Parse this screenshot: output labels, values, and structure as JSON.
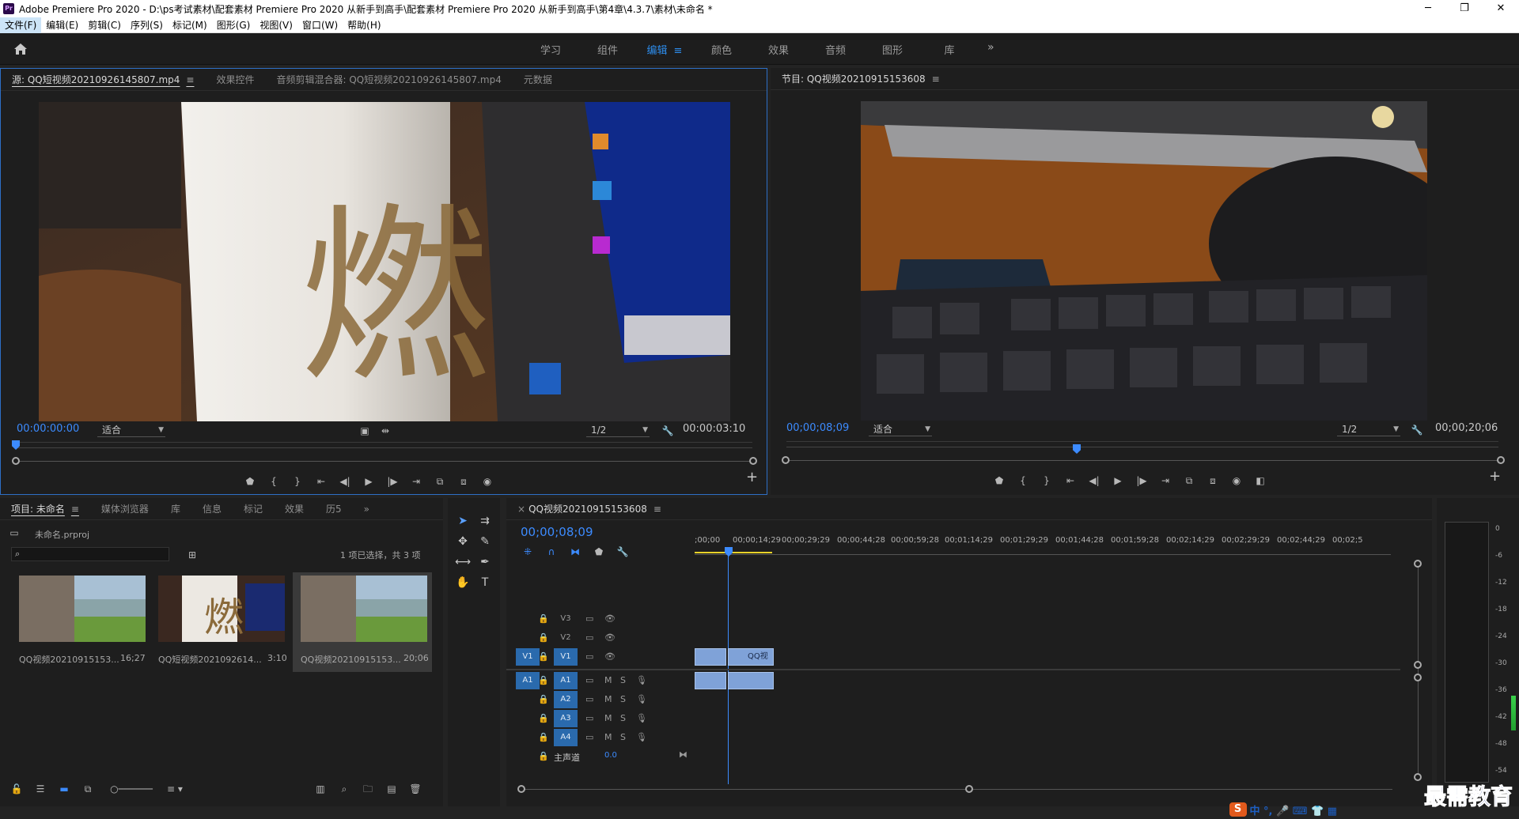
{
  "window": {
    "app_icon": "Pr",
    "title": "Adobe Premiere Pro 2020 - D:\\ps考试素材\\配套素材 Premiere Pro 2020 从新手到高手\\配套素材 Premiere Pro 2020 从新手到高手\\第4章\\4.3.7\\素材\\未命名 *",
    "controls": [
      "─",
      "❐",
      "✕"
    ]
  },
  "menu": [
    "文件(F)",
    "编辑(E)",
    "剪辑(C)",
    "序列(S)",
    "标记(M)",
    "图形(G)",
    "视图(V)",
    "窗口(W)",
    "帮助(H)"
  ],
  "workspaces": {
    "tabs": [
      "学习",
      "组件",
      "编辑",
      "颜色",
      "效果",
      "音频",
      "图形",
      "库"
    ],
    "active": "编辑",
    "more": "»"
  },
  "source_panel": {
    "tabs": [
      "源: QQ短视频20210926145807.mp4",
      "效果控件",
      "音频剪辑混合器: QQ短视频20210926145807.mp4",
      "元数据"
    ],
    "timecode": "00:00:00:00",
    "fit": "适合",
    "resolution": "1/2",
    "duration": "00:00:03:10"
  },
  "program_panel": {
    "tab": "节目: QQ视频20210915153608",
    "timecode": "00;00;08;09",
    "fit": "适合",
    "resolution": "1/2",
    "duration": "00;00;20;06"
  },
  "project_panel": {
    "tabs": [
      "项目: 未命名",
      "媒体浏览器",
      "库",
      "信息",
      "标记",
      "效果",
      "历5"
    ],
    "project_file": "未命名.prproj",
    "search_placeholder": "",
    "selection_info": "1 项已选择，共 3 项",
    "items": [
      {
        "name": "QQ视频20210915153...",
        "duration": "16;27"
      },
      {
        "name": "QQ短视频2021092614...",
        "duration": "3:10"
      },
      {
        "name": "QQ视频20210915153...",
        "duration": "20;06"
      }
    ]
  },
  "timeline": {
    "tab": "QQ视频20210915153608",
    "timecode": "00;00;08;09",
    "ruler": [
      ";00;00",
      "00;00;14;29",
      "00;00;29;29",
      "00;00;44;28",
      "00;00;59;28",
      "00;01;14;29",
      "00;01;29;29",
      "00;01;44;28",
      "00;01;59;28",
      "00;02;14;29",
      "00;02;29;29",
      "00;02;44;29",
      "00;02;5"
    ],
    "video_tracks": [
      "V3",
      "V2",
      "V1"
    ],
    "audio_tracks": [
      "A1",
      "A2",
      "A3",
      "A4"
    ],
    "source_patch_video": "V1",
    "source_patch_audio": "A1",
    "mute": "M",
    "solo": "S",
    "master_label": "主声道",
    "master_value": "0.0",
    "clip_label": "QQ视"
  },
  "meters": {
    "labels": [
      "0",
      "-6",
      "-12",
      "-18",
      "-24",
      "-30",
      "-36",
      "-42",
      "-48",
      "-54"
    ]
  },
  "overlay": {
    "watermark": "最需教育",
    "ime_logo": "S",
    "ime_text": "中 °, 🎤 ⌨ 👕 ▦"
  }
}
